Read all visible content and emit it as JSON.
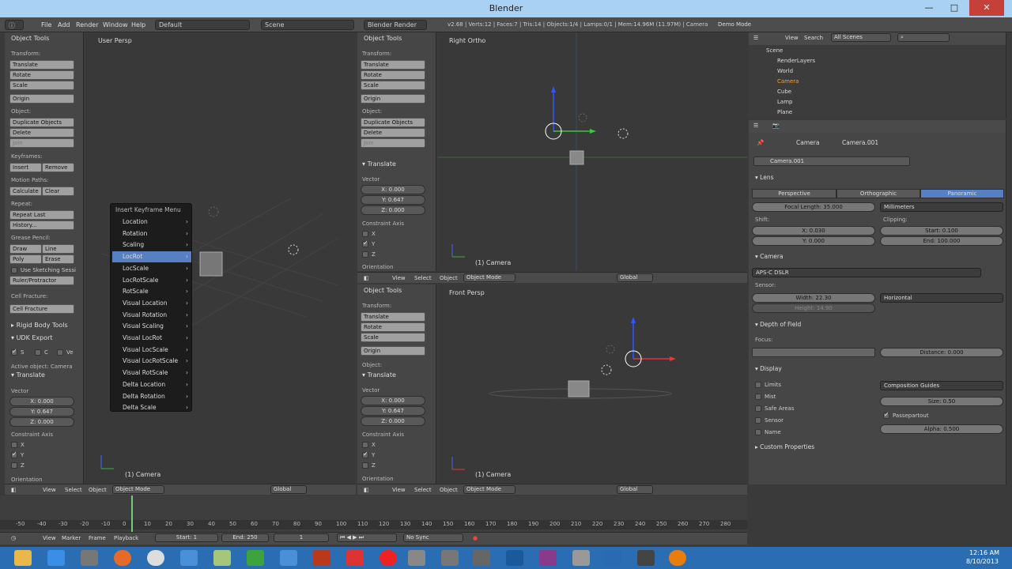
{
  "window": {
    "title": "Blender",
    "min": "—",
    "max": "□",
    "close": "✕"
  },
  "info": {
    "menus": [
      "File",
      "Add",
      "Render",
      "Window",
      "Help"
    ],
    "layout": "Default",
    "scene": "Scene",
    "engine": "Blender Render",
    "stats": "v2.68 | Verts:12 | Faces:7 | Tris:14 | Objects:1/4 | Lamps:0/1 | Mem:14.96M (11.97M) | Camera",
    "demo": "Demo Mode"
  },
  "left_panel": {
    "title": "Object Tools",
    "transform": "Transform:",
    "translate": "Translate",
    "rotate": "Rotate",
    "scale": "Scale",
    "origin": "Origin",
    "object": "Object:",
    "duplicate": "Duplicate Objects",
    "delete": "Delete",
    "join": "Join",
    "keyframes": "Keyframes:",
    "insert": "Insert",
    "remove": "Remove",
    "motion_paths": "Motion Paths:",
    "calculate": "Calculate",
    "clear": "Clear",
    "repeat": "Repeat:",
    "repeat_last": "Repeat Last",
    "history": "History...",
    "grease": "Grease Pencil:",
    "draw": "Draw",
    "line": "Line",
    "poly": "Poly",
    "erase": "Erase",
    "use_sketch": "Use Sketching Sessi",
    "ruler": "Ruler/Protractor",
    "cell_fracture_h": "Cell Fracture:",
    "cell_fracture": "Cell Fracture",
    "rigid": "Rigid Body Tools",
    "udk": "UDK Export",
    "udk_s": "S",
    "udk_c": "C",
    "udk_ve": "Ve",
    "active_obj": "Active object: Camera",
    "translate_sec": "Translate",
    "vector": "Vector",
    "x": "X: 0.000",
    "y": "Y: 0.647",
    "z": "Z: 0.000",
    "constraint": "Constraint Axis",
    "cx": "X",
    "cy": "Y",
    "cz": "Z",
    "orientation": "Orientation"
  },
  "vp_left": {
    "label": "User Persp",
    "camera": "(1) Camera"
  },
  "ctx": {
    "title": "Insert Keyframe Menu",
    "items": [
      "Location",
      "Rotation",
      "Scaling",
      "LocRot",
      "LocScale",
      "LocRotScale",
      "RotScale",
      "Visual Location",
      "Visual Rotation",
      "Visual Scaling",
      "Visual LocRot",
      "Visual LocScale",
      "Visual LocRotScale",
      "Visual RotScale",
      "Delta Location",
      "Delta Rotation",
      "Delta Scale"
    ],
    "arrow": "›"
  },
  "mid_top": {
    "title": "Object Tools",
    "transform": "Transform:",
    "translate": "Translate",
    "rotate": "Rotate",
    "scale": "Scale",
    "origin": "Origin",
    "object": "Object:",
    "duplicate": "Duplicate Objects",
    "delete": "Delete",
    "join": "Join",
    "translate_sec": "Translate",
    "vector": "Vector",
    "x": "X: 0.000",
    "y": "Y: 0.647",
    "z": "Z: 0.000",
    "constraint": "Constraint Axis",
    "cx": "X",
    "cy": "Y",
    "cz": "Z",
    "orientation": "Orientation"
  },
  "vp_right_top": {
    "label": "Right Ortho",
    "camera": "(1) Camera"
  },
  "mid_bottom": {
    "title": "Object Tools",
    "transform": "Transform:",
    "translate": "Translate",
    "rotate": "Rotate",
    "scale": "Scale",
    "origin": "Origin",
    "object": "Object:",
    "translate_sec": "Translate",
    "vector": "Vector",
    "x": "X: 0.000",
    "y": "Y: 0.647",
    "z": "Z: 0.000",
    "constraint": "Constraint Axis",
    "cx": "X",
    "cy": "Y",
    "cz": "Z",
    "orientation": "Orientation"
  },
  "vp_right_bottom": {
    "label": "Front Persp",
    "camera": "(1) Camera"
  },
  "vheader": {
    "view": "View",
    "select": "Select",
    "object": "Object",
    "mode": "Object Mode",
    "global": "Global"
  },
  "outliner": {
    "view": "View",
    "search": "Search",
    "scenes": "All Scenes",
    "items": [
      "Scene",
      "RenderLayers",
      "World",
      "Camera",
      "Cube",
      "Lamp",
      "Plane"
    ]
  },
  "props": {
    "breadcrumb_cam": "Camera",
    "breadcrumb_data": "Camera.001",
    "name": "Camera.001",
    "lens": "Lens",
    "perspective": "Perspective",
    "orthographic": "Orthographic",
    "panoramic": "Panoramic",
    "focal": "Focal Length: 35.000",
    "units": "Millimeters",
    "shift": "Shift:",
    "clipping": "Clipping:",
    "shift_x": "X: 0.030",
    "shift_y": "Y: 0.000",
    "clip_start": "Start: 0.100",
    "clip_end": "End: 100.000",
    "camera": "Camera",
    "preset": "APS-C DSLR",
    "sensor": "Sensor:",
    "width": "Width: 22.30",
    "height": "Height: 14.90",
    "fit": "Horizontal",
    "dof": "Depth of Field",
    "focus": "Focus:",
    "distance": "Distance: 0.000",
    "display": "Display",
    "limits": "Limits",
    "mist": "Mist",
    "safe": "Safe Areas",
    "sensor_chk": "Sensor",
    "name_chk": "Name",
    "guides": "Composition Guides",
    "size": "Size: 0.50",
    "passepartout": "Passepartout",
    "alpha": "Alpha: 0.500",
    "custom": "Custom Properties"
  },
  "timeline": {
    "ticks": [
      "-50",
      "-40",
      "-30",
      "-20",
      "-10",
      "0",
      "10",
      "20",
      "30",
      "40",
      "50",
      "60",
      "70",
      "80",
      "90",
      "100",
      "110",
      "120",
      "130",
      "140",
      "150",
      "160",
      "170",
      "180",
      "190",
      "200",
      "210",
      "220",
      "230",
      "240",
      "250",
      "260",
      "270",
      "280"
    ],
    "view": "View",
    "marker": "Marker",
    "frame": "Frame",
    "playback": "Playback",
    "start": "Start: 1",
    "end": "End: 250",
    "current": "1",
    "sync": "No Sync"
  },
  "taskbar": {
    "time": "12:16 AM",
    "date": "8/10/2013"
  }
}
